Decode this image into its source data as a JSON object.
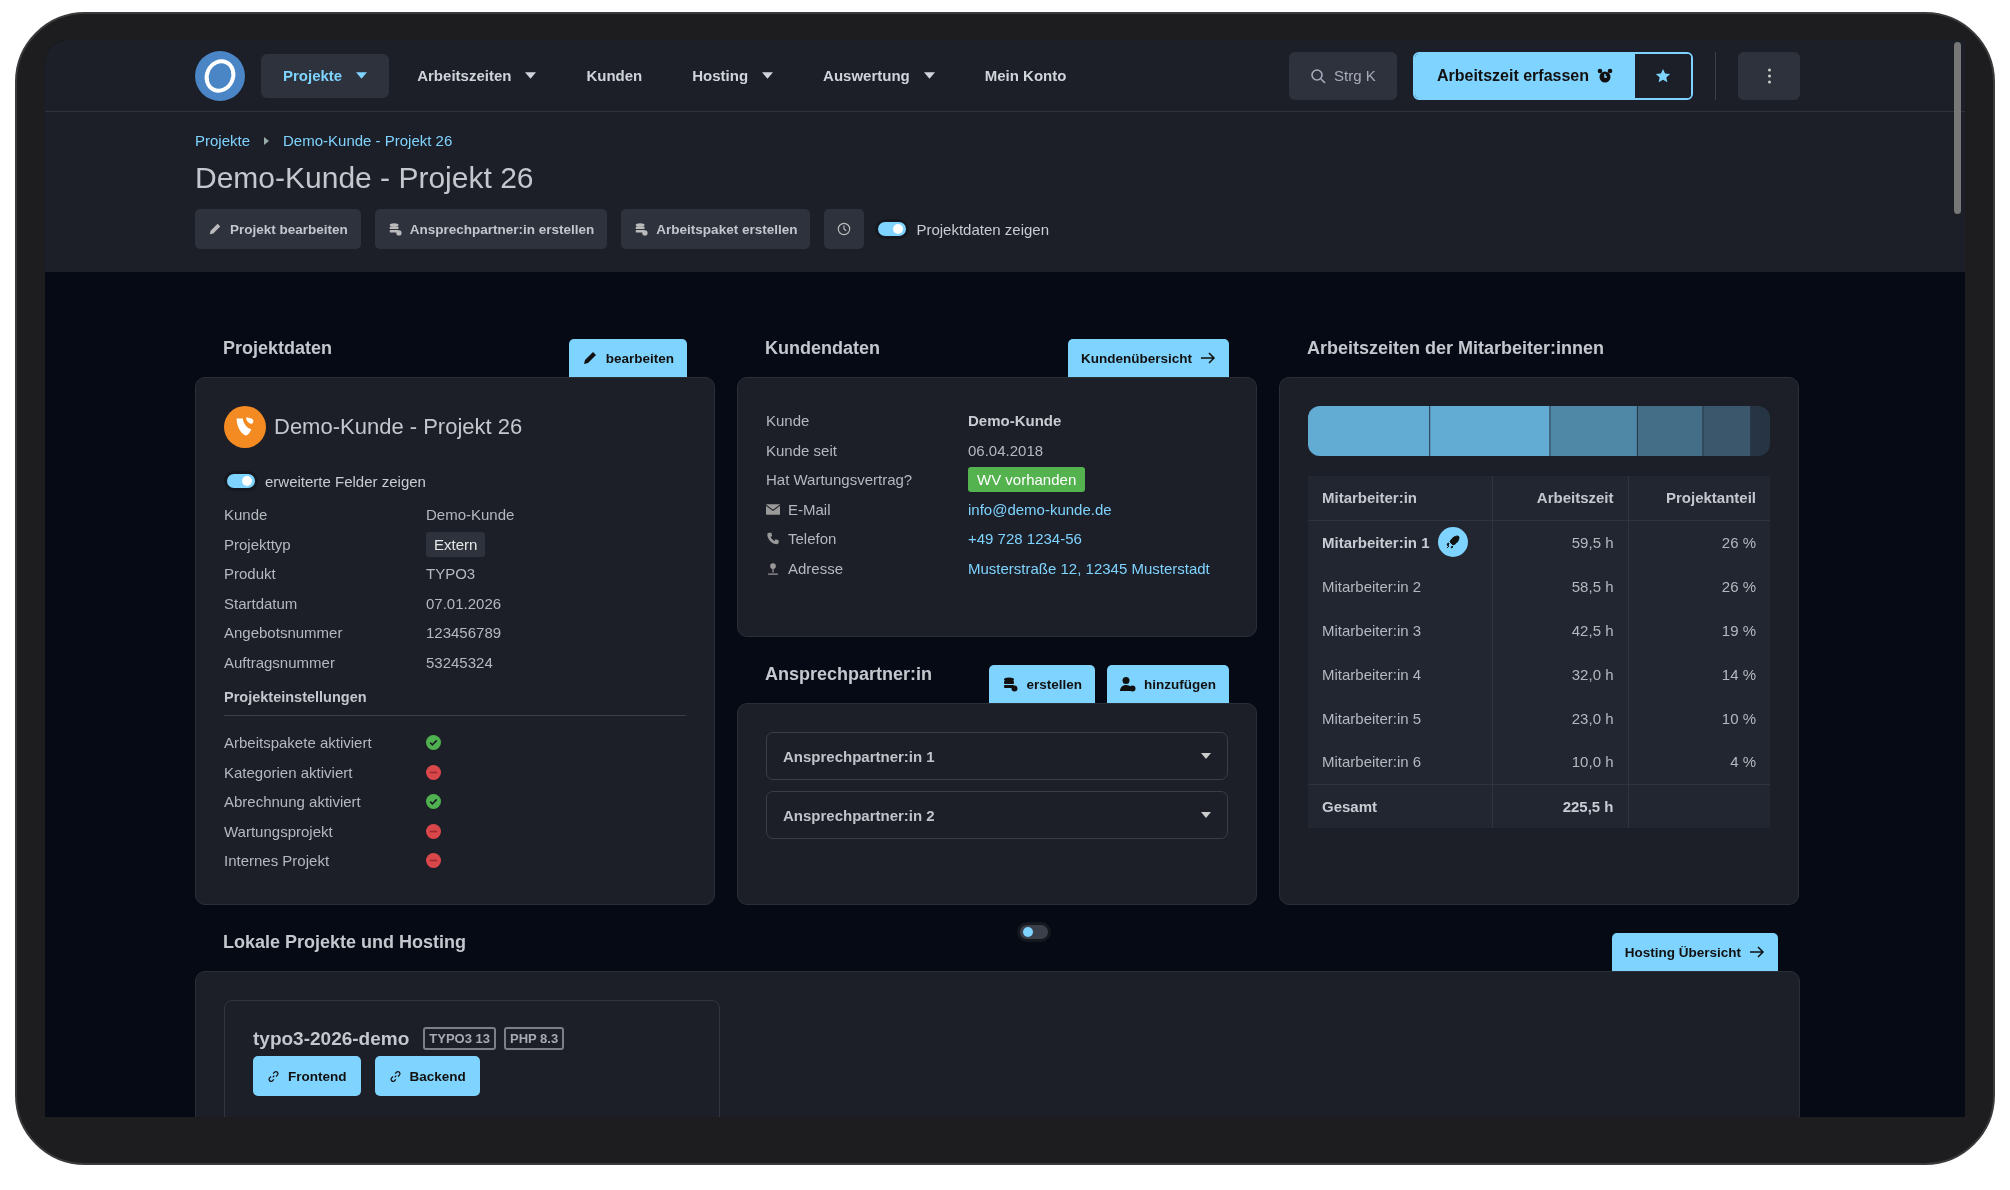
{
  "nav": {
    "items": [
      {
        "label": "Projekte",
        "selected": true,
        "dropdown": true
      },
      {
        "label": "Arbeitszeiten",
        "selected": false,
        "dropdown": true
      },
      {
        "label": "Kunden",
        "selected": false,
        "dropdown": false
      },
      {
        "label": "Hosting",
        "selected": false,
        "dropdown": true
      },
      {
        "label": "Auswertung",
        "selected": false,
        "dropdown": true
      },
      {
        "label": "Mein Konto",
        "selected": false,
        "dropdown": false
      }
    ],
    "search": "Strg K",
    "primary_button": "Arbeitszeit erfassen"
  },
  "breadcrumb": [
    "Projekte",
    "Demo-Kunde - Projekt 26"
  ],
  "title": "Demo-Kunde - Projekt 26",
  "actions": [
    {
      "label": "Projekt bearbeiten",
      "kind": "edit"
    },
    {
      "label": "Ansprechpartner:in erstellen",
      "kind": "create"
    },
    {
      "label": "Arbeitspaket erstellen",
      "kind": "create"
    }
  ],
  "project_toggle": {
    "label": "Projektdaten zeigen",
    "on": true
  },
  "projektdaten": {
    "heading": "Projektdaten",
    "edit_button": "bearbeiten",
    "name": "Demo-Kunde - Projekt 26",
    "toggle": {
      "label": "erweiterte Felder zeigen",
      "on": true
    },
    "fields": [
      {
        "label": "Kunde",
        "value": "Demo-Kunde",
        "kind": "text"
      },
      {
        "label": "Projekttyp",
        "value": "Extern",
        "kind": "tag"
      },
      {
        "label": "Produkt",
        "value": "TYPO3",
        "kind": "text"
      },
      {
        "label": "Startdatum",
        "value": "07.01.2026",
        "kind": "text"
      },
      {
        "label": "Angebotsnummer",
        "value": "123456789",
        "kind": "text"
      },
      {
        "label": "Auftragsnummer",
        "value": "53245324",
        "kind": "text"
      }
    ],
    "settings_heading": "Projekteinstellungen",
    "settings": [
      {
        "label": "Arbeitspakete aktiviert",
        "enabled": true
      },
      {
        "label": "Kategorien aktiviert",
        "enabled": false
      },
      {
        "label": "Abrechnung aktiviert",
        "enabled": true
      },
      {
        "label": "Wartungsprojekt",
        "enabled": false
      },
      {
        "label": "Internes Projekt",
        "enabled": false
      }
    ]
  },
  "kundendaten": {
    "heading": "Kundendaten",
    "overview_button": "Kundenübersicht",
    "fields": [
      {
        "label": "Kunde",
        "value": "Demo-Kunde",
        "kind": "bold"
      },
      {
        "label": "Kunde seit",
        "value": "06.04.2018",
        "kind": "text"
      },
      {
        "label": "Hat Wartungsvertrag?",
        "value": "WV vorhanden",
        "kind": "badge"
      },
      {
        "label": "E-Mail",
        "value": "info@demo-kunde.de",
        "kind": "email"
      },
      {
        "label": "Telefon",
        "value": "+49 728 1234-56",
        "kind": "phone"
      },
      {
        "label": "Adresse",
        "value": "Musterstraße 12, 12345 Musterstadt",
        "kind": "address"
      }
    ]
  },
  "ansprechpartner": {
    "heading": "Ansprechpartner:in",
    "buttons": [
      {
        "label": "erstellen",
        "kind": "create"
      },
      {
        "label": "hinzufügen",
        "kind": "add"
      }
    ],
    "contacts": [
      "Ansprechpartner:in 1",
      "Ansprechpartner:in 2"
    ]
  },
  "arbeitszeiten": {
    "heading": "Arbeitszeiten der Mitarbeiter:innen",
    "columns": [
      "Mitarbeiter:in",
      "Arbeitszeit",
      "Projektanteil"
    ],
    "rows": [
      {
        "name": "Mitarbeiter:in 1",
        "time": "59,5 h",
        "share": "26 %",
        "lead": true
      },
      {
        "name": "Mitarbeiter:in 2",
        "time": "58,5 h",
        "share": "26 %",
        "lead": false
      },
      {
        "name": "Mitarbeiter:in 3",
        "time": "42,5 h",
        "share": "19 %",
        "lead": false
      },
      {
        "name": "Mitarbeiter:in 4",
        "time": "32,0 h",
        "share": "14 %",
        "lead": false
      },
      {
        "name": "Mitarbeiter:in 5",
        "time": "23,0 h",
        "share": "10 %",
        "lead": false
      },
      {
        "name": "Mitarbeiter:in 6",
        "time": "10,0 h",
        "share": "4 %",
        "lead": false
      }
    ],
    "total": {
      "label": "Gesamt",
      "time": "225,5 h"
    }
  },
  "hosting": {
    "heading": "Lokale Projekte und Hosting",
    "toggle": {
      "on": false
    },
    "overview_button": "Hosting Übersicht",
    "projects": [
      {
        "name": "typo3-2026-demo",
        "tags": [
          "TYPO3 13",
          "PHP 8.3"
        ],
        "links": [
          "Frontend",
          "Backend"
        ]
      }
    ]
  }
}
